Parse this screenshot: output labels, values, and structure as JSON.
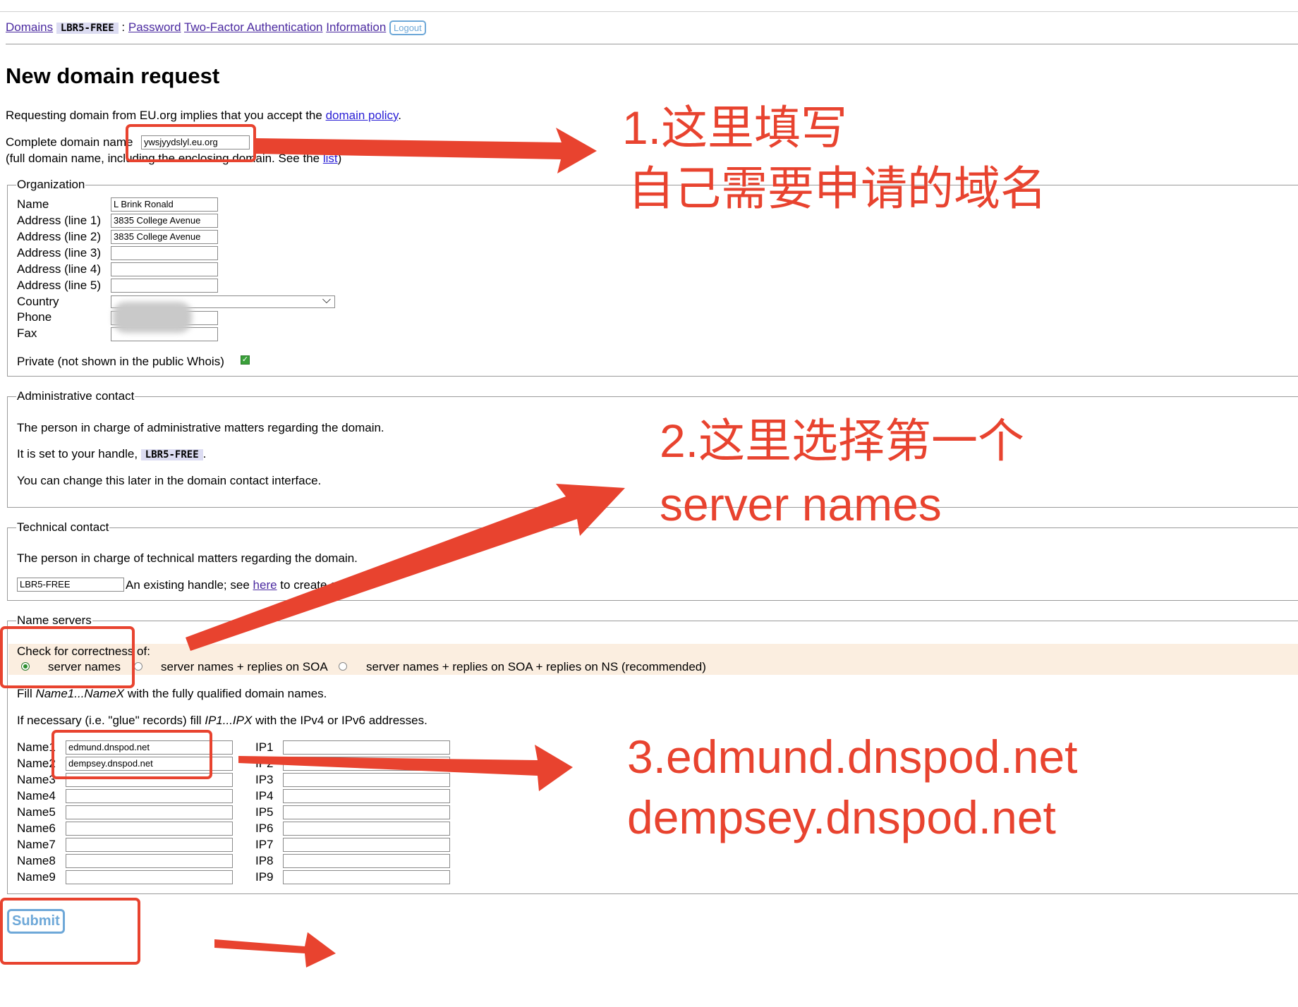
{
  "nav": {
    "domains": "Domains",
    "handle": "LBR5-FREE",
    "sep": ":",
    "password": "Password",
    "two_factor": "Two-Factor Authentication",
    "information": "Information",
    "logout": "Logout"
  },
  "title": "New domain request",
  "policy": {
    "prefix": "Requesting domain from EU.org implies that you accept the",
    "link": "domain policy",
    "suffix": "."
  },
  "domain_field": {
    "label": "Complete domain name",
    "value": "ywsjyydslyl.eu.org",
    "help_prefix": "(full domain name, including the enclosing domain. See the",
    "help_link": "list",
    "help_suffix": ")"
  },
  "organization": {
    "legend": "Organization",
    "name_label": "Name",
    "name_value": "L Brink Ronald",
    "addr1_label": "Address (line 1)",
    "addr1_value": "3835 College Avenue",
    "addr2_label": "Address (line 2)",
    "addr2_value": "3835 College Avenue",
    "addr3_label": "Address (line 3)",
    "addr4_label": "Address (line 4)",
    "addr5_label": "Address (line 5)",
    "country_label": "Country",
    "phone_label": "Phone",
    "fax_label": "Fax",
    "private_label": "Private (not shown in the public Whois)",
    "private_checked": true
  },
  "admin": {
    "legend": "Administrative contact",
    "line1": "The person in charge of administrative matters regarding the domain.",
    "line2_prefix": "It is set to your handle,",
    "handle": "LBR5-FREE",
    "line2_suffix": ".",
    "line3": "You can change this later in the domain contact interface."
  },
  "tech": {
    "legend": "Technical contact",
    "line1": "The person in charge of technical matters regarding the domain.",
    "handle_value": "LBR5-FREE",
    "hint_prefix": "An existing handle; see",
    "hint_link": "here",
    "hint_suffix": "to create on"
  },
  "nameservers": {
    "legend": "Name servers",
    "check_label": "Check for correctness of:",
    "options": [
      "server names",
      "server names + replies on SOA",
      "server names + replies on SOA + replies on NS (recommended)"
    ],
    "selected": 0,
    "fill1_a": "Fill",
    "fill1_em": "Name1...NameX",
    "fill1_b": "with the fully qualified domain names.",
    "fill2_a": "If necessary (i.e. \"glue\" records) fill",
    "fill2_em": "IP1...IPX",
    "fill2_b": "with the IPv4 or IPv6 addresses.",
    "rows": [
      {
        "name": "Name1",
        "value": "edmund.dnspod.net",
        "ip": "IP1"
      },
      {
        "name": "Name2",
        "value": "dempsey.dnspod.net",
        "ip": "IP2"
      },
      {
        "name": "Name3",
        "value": "",
        "ip": "IP3"
      },
      {
        "name": "Name4",
        "value": "",
        "ip": "IP4"
      },
      {
        "name": "Name5",
        "value": "",
        "ip": "IP5"
      },
      {
        "name": "Name6",
        "value": "",
        "ip": "IP6"
      },
      {
        "name": "Name7",
        "value": "",
        "ip": "IP7"
      },
      {
        "name": "Name8",
        "value": "",
        "ip": "IP8"
      },
      {
        "name": "Name9",
        "value": "",
        "ip": "IP9"
      }
    ]
  },
  "submit": "Submit",
  "annotations": {
    "note1_line1": "1.这里填写",
    "note1_line2": "自己需要申请的域名",
    "note2_line1": "2.这里选择第一个",
    "note2_line2": "server names",
    "note3_line1": "3.edmund.dnspod.net",
    "note3_line2": "dempsey.dnspod.net",
    "color": "#e8432f"
  }
}
